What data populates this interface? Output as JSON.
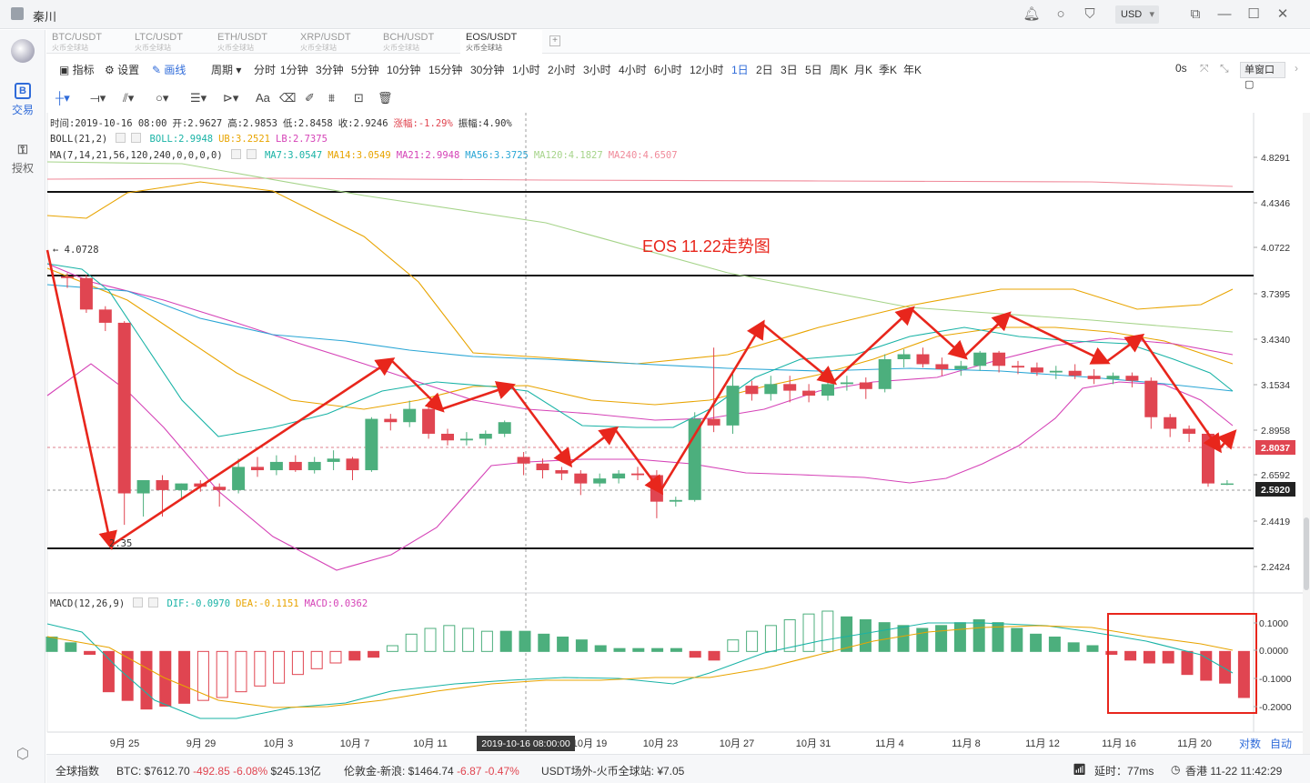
{
  "titlebar": {
    "user": "秦川",
    "currency": "USD"
  },
  "sidebar": {
    "items": [
      {
        "label": "交易",
        "icon": "B"
      },
      {
        "label": "授权",
        "icon": "⚿"
      }
    ]
  },
  "tabs": [
    {
      "pair": "BTC/USDT",
      "exchange": "火币全球站",
      "active": false
    },
    {
      "pair": "LTC/USDT",
      "exchange": "火币全球站",
      "active": false
    },
    {
      "pair": "ETH/USDT",
      "exchange": "火币全球站",
      "active": false
    },
    {
      "pair": "XRP/USDT",
      "exchange": "火币全球站",
      "active": false
    },
    {
      "pair": "BCH/USDT",
      "exchange": "火币全球站",
      "active": false
    },
    {
      "pair": "EOS/USDT",
      "exchange": "火币全球站",
      "active": true
    }
  ],
  "toolbar": {
    "indicator": "指标",
    "settings": "设置",
    "draw": "画线",
    "period": "周期",
    "periods": [
      "分时",
      "1分钟",
      "3分钟",
      "5分钟",
      "10分钟",
      "15分钟",
      "30分钟",
      "1小时",
      "2小时",
      "3小时",
      "4小时",
      "6小时",
      "12小时",
      "1日",
      "2日",
      "3日",
      "5日",
      "周K",
      "月K",
      "季K",
      "年K"
    ],
    "active_period": "1日",
    "zero_s": "0s",
    "window": "单窗口"
  },
  "info": {
    "time": "时间:2019-10-16 08:00",
    "open": "开:2.9627",
    "high": "高:2.9853",
    "low": "低:2.8458",
    "close": "收:2.9246",
    "change": "涨幅:-1.29%",
    "amplitude": "振幅:4.90%",
    "boll": "BOLL(21,2)",
    "boll_mid": "BOLL:2.9948",
    "boll_ub": "UB:3.2521",
    "boll_lb": "LB:2.7375",
    "ma": "MA(7,14,21,56,120,240,0,0,0,0)",
    "ma7": "MA7:3.0547",
    "ma14": "MA14:3.0549",
    "ma21": "MA21:2.9948",
    "ma56": "MA56:3.3725",
    "ma120": "MA120:4.1827",
    "ma240": "MA240:4.6507",
    "macd": "MACD(12,26,9)",
    "dif": "DIF:-0.0970",
    "dea": "DEA:-0.1151",
    "macd_val": "MACD:0.0362"
  },
  "annotation": {
    "title": "EOS 11.22走势图",
    "high_mark": "4.0728",
    "low_mark": "2.35"
  },
  "price_axis": [
    "4.8291",
    "4.4346",
    "4.0722",
    "3.7395",
    "3.4340",
    "3.1534",
    "2.8958",
    "2.6592",
    "2.4419",
    "2.2424"
  ],
  "price_tags": {
    "current": "2.8037",
    "line": "2.5920"
  },
  "macd_axis": [
    "0.1000",
    "0.0000",
    "-0.1000",
    "-0.2000"
  ],
  "date_axis": [
    "9月 25",
    "9月 29",
    "10月 3",
    "10月 7",
    "10月 11",
    "10月 19",
    "10月 23",
    "10月 27",
    "10月 31",
    "11月 4",
    "11月 8",
    "11月 12",
    "11月 16",
    "11月 20"
  ],
  "crosshair_label": "2019-10-16 08:00:00",
  "axis_buttons": {
    "log": "对数",
    "auto": "自动"
  },
  "status": {
    "index": "全球指数",
    "btc_price": "BTC: $7612.70",
    "btc_chg": "-492.85",
    "btc_pct": "-6.08%",
    "btc_vol": "$245.13亿",
    "gold": "伦敦金-新浪: $1464.74",
    "gold_chg": "-6.87",
    "gold_pct": "-0.47%",
    "usdt": "USDT场外-火币全球站: ¥7.05",
    "latency": "延时：77ms",
    "clock": "香港 11-22 11:42:29"
  },
  "colors": {
    "up": "#4caf7d",
    "down": "#e04551",
    "accent": "#2f6bd9",
    "arrow": "#e8261c"
  },
  "chart_data": {
    "type": "candlestick",
    "dates": [
      "9/22",
      "9/23",
      "9/24",
      "9/25",
      "9/26",
      "9/27",
      "9/28",
      "9/29",
      "9/30",
      "10/1",
      "10/2",
      "10/3",
      "10/4",
      "10/5",
      "10/6",
      "10/7",
      "10/8",
      "10/9",
      "10/10",
      "10/11",
      "10/12",
      "10/13",
      "10/14",
      "10/15",
      "10/16",
      "10/17",
      "10/18",
      "10/19",
      "10/20",
      "10/21",
      "10/22",
      "10/23",
      "10/24",
      "10/25",
      "10/26",
      "10/27",
      "10/28",
      "10/29",
      "10/30",
      "10/31",
      "11/1",
      "11/2",
      "11/3",
      "11/4",
      "11/5",
      "11/6",
      "11/7",
      "11/8",
      "11/9",
      "11/10",
      "11/11",
      "11/12",
      "11/13",
      "11/14",
      "11/15",
      "11/16",
      "11/17",
      "11/18",
      "11/19",
      "11/20",
      "11/21",
      "11/22"
    ],
    "ohlc": [
      [
        4.05,
        4.07,
        3.98,
        4.04
      ],
      [
        4.04,
        4.06,
        3.83,
        3.85
      ],
      [
        3.85,
        3.87,
        3.72,
        3.77
      ],
      [
        3.77,
        3.78,
        2.55,
        2.74
      ],
      [
        2.74,
        2.8,
        2.6,
        2.82
      ],
      [
        2.82,
        2.85,
        2.6,
        2.76
      ],
      [
        2.76,
        2.8,
        2.7,
        2.8
      ],
      [
        2.8,
        2.82,
        2.75,
        2.78
      ],
      [
        2.78,
        2.8,
        2.66,
        2.76
      ],
      [
        2.76,
        2.95,
        2.74,
        2.9
      ],
      [
        2.9,
        2.96,
        2.84,
        2.88
      ],
      [
        2.88,
        2.97,
        2.85,
        2.93
      ],
      [
        2.93,
        2.97,
        2.87,
        2.88
      ],
      [
        2.88,
        2.96,
        2.86,
        2.93
      ],
      [
        2.93,
        3.0,
        2.88,
        2.95
      ],
      [
        2.95,
        2.96,
        2.82,
        2.88
      ],
      [
        2.88,
        3.2,
        2.87,
        3.19
      ],
      [
        3.19,
        3.22,
        3.12,
        3.17
      ],
      [
        3.17,
        3.3,
        3.14,
        3.25
      ],
      [
        3.25,
        3.27,
        3.07,
        3.1
      ],
      [
        3.1,
        3.13,
        3.03,
        3.06
      ],
      [
        3.06,
        3.11,
        3.03,
        3.07
      ],
      [
        3.07,
        3.12,
        3.03,
        3.1
      ],
      [
        3.1,
        3.18,
        3.08,
        3.17
      ],
      [
        2.96,
        2.99,
        2.85,
        2.92
      ],
      [
        2.92,
        2.95,
        2.83,
        2.88
      ],
      [
        2.88,
        2.9,
        2.82,
        2.86
      ],
      [
        2.86,
        2.88,
        2.73,
        2.8
      ],
      [
        2.8,
        2.86,
        2.78,
        2.83
      ],
      [
        2.83,
        2.88,
        2.8,
        2.86
      ],
      [
        2.86,
        2.9,
        2.82,
        2.85
      ],
      [
        2.85,
        2.88,
        2.59,
        2.69
      ],
      [
        2.69,
        2.72,
        2.66,
        2.7
      ],
      [
        2.7,
        3.23,
        2.69,
        3.19
      ],
      [
        3.19,
        3.62,
        3.11,
        3.15
      ],
      [
        3.15,
        3.48,
        3.1,
        3.39
      ],
      [
        3.39,
        3.42,
        3.3,
        3.34
      ],
      [
        3.34,
        3.45,
        3.3,
        3.4
      ],
      [
        3.4,
        3.45,
        3.29,
        3.36
      ],
      [
        3.36,
        3.4,
        3.29,
        3.33
      ],
      [
        3.33,
        3.42,
        3.3,
        3.4
      ],
      [
        3.4,
        3.45,
        3.36,
        3.41
      ],
      [
        3.41,
        3.44,
        3.31,
        3.37
      ],
      [
        3.37,
        3.58,
        3.35,
        3.55
      ],
      [
        3.55,
        3.61,
        3.5,
        3.58
      ],
      [
        3.58,
        3.62,
        3.5,
        3.52
      ],
      [
        3.52,
        3.56,
        3.45,
        3.49
      ],
      [
        3.49,
        3.54,
        3.45,
        3.51
      ],
      [
        3.51,
        3.6,
        3.48,
        3.59
      ],
      [
        3.59,
        3.6,
        3.47,
        3.51
      ],
      [
        3.51,
        3.54,
        3.46,
        3.5
      ],
      [
        3.5,
        3.53,
        3.45,
        3.47
      ],
      [
        3.47,
        3.51,
        3.43,
        3.48
      ],
      [
        3.48,
        3.52,
        3.43,
        3.45
      ],
      [
        3.45,
        3.49,
        3.4,
        3.43
      ],
      [
        3.43,
        3.47,
        3.4,
        3.45
      ],
      [
        3.45,
        3.47,
        3.38,
        3.42
      ],
      [
        3.42,
        3.44,
        3.13,
        3.2
      ],
      [
        3.2,
        3.22,
        3.08,
        3.13
      ],
      [
        3.13,
        3.15,
        3.05,
        3.1
      ],
      [
        3.1,
        3.12,
        2.78,
        2.8
      ],
      [
        2.8,
        2.82,
        2.79,
        2.8
      ]
    ],
    "macd_hist": [
      0.05,
      0.03,
      -0.01,
      -0.14,
      -0.17,
      -0.2,
      -0.19,
      -0.18,
      -0.17,
      -0.16,
      -0.14,
      -0.12,
      -0.11,
      -0.08,
      -0.06,
      -0.04,
      -0.03,
      -0.02,
      0.02,
      0.06,
      0.08,
      0.09,
      0.08,
      0.07,
      0.07,
      0.07,
      0.06,
      0.05,
      0.04,
      0.02,
      0.01,
      0.01,
      0.01,
      0.01,
      -0.02,
      -0.03,
      0.04,
      0.07,
      0.09,
      0.11,
      0.13,
      0.14,
      0.12,
      0.11,
      0.1,
      0.09,
      0.08,
      0.09,
      0.1,
      0.11,
      0.1,
      0.08,
      0.06,
      0.05,
      0.03,
      0.02,
      -0.01,
      -0.03,
      -0.04,
      -0.04,
      -0.08,
      -0.1,
      -0.11,
      -0.16,
      -0.17
    ],
    "price_ylim": [
      2.15,
      4.95
    ],
    "macd_ylim": [
      -0.28,
      0.14
    ]
  }
}
